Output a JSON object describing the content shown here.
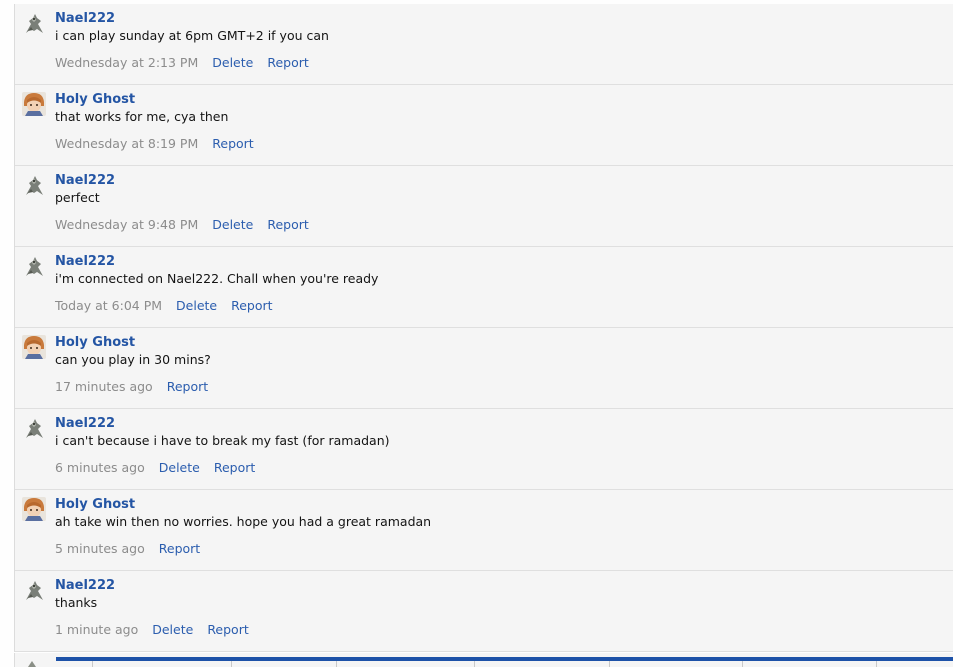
{
  "messages": [
    {
      "user": "Nael222",
      "avatar": "nael",
      "text": "i can play sunday at 6pm GMT+2 if you can",
      "time": "Wednesday at 2:13 PM",
      "delete": "Delete",
      "report": "Report"
    },
    {
      "user": "Holy Ghost",
      "avatar": "holy",
      "text": "that works for me, cya then",
      "time": "Wednesday at 8:19 PM",
      "delete": null,
      "report": "Report"
    },
    {
      "user": "Nael222",
      "avatar": "nael",
      "text": "perfect",
      "time": "Wednesday at 9:48 PM",
      "delete": "Delete",
      "report": "Report"
    },
    {
      "user": "Nael222",
      "avatar": "nael",
      "text": "i'm connected on Nael222. Chall when you're ready",
      "time": "Today at 6:04 PM",
      "delete": "Delete",
      "report": "Report"
    },
    {
      "user": "Holy Ghost",
      "avatar": "holy",
      "text": "can you play in 30 mins?",
      "time": "17 minutes ago",
      "delete": null,
      "report": "Report"
    },
    {
      "user": "Nael222",
      "avatar": "nael",
      "text": "i can't because i have to break my fast (for ramadan)",
      "time": "6 minutes ago",
      "delete": "Delete",
      "report": "Report"
    },
    {
      "user": "Holy Ghost",
      "avatar": "holy",
      "text": "ah take win then no worries. hope you had a great ramadan",
      "time": "5 minutes ago",
      "delete": null,
      "report": "Report"
    },
    {
      "user": "Nael222",
      "avatar": "nael",
      "text": "thanks",
      "time": "1 minute ago",
      "delete": "Delete",
      "report": "Report"
    }
  ],
  "colors": {
    "username": "#2455a4",
    "link": "#2b5dae",
    "meta": "#8c8c8c",
    "row_bg": "#f5f5f5",
    "accent_bar": "#1d52a8"
  }
}
